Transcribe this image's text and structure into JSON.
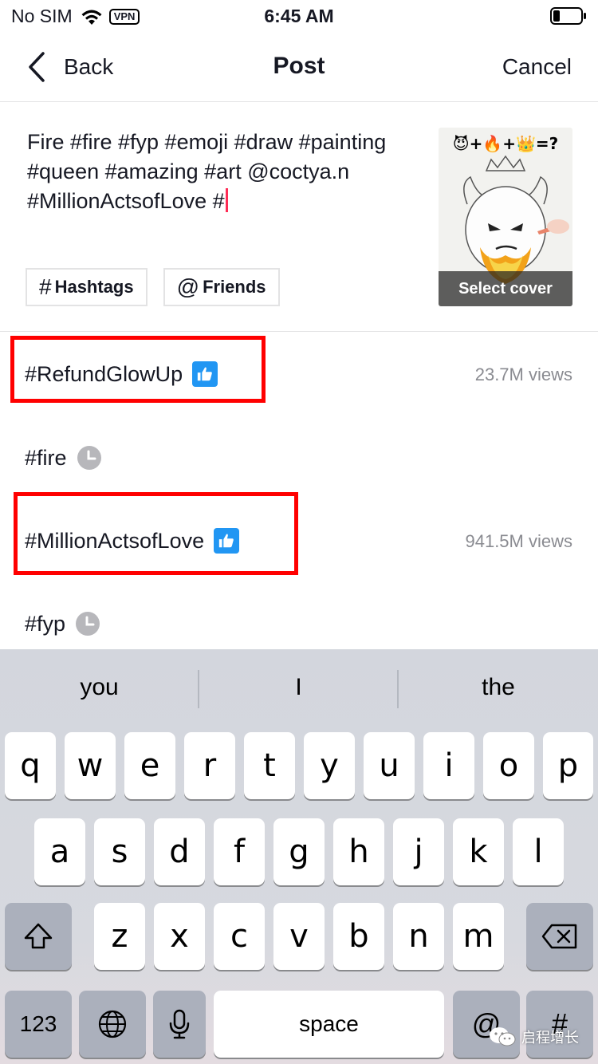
{
  "status_bar": {
    "carrier": "No SIM",
    "vpn": "VPN",
    "time": "6:45 AM"
  },
  "nav": {
    "back_label": "Back",
    "title": "Post",
    "cancel_label": "Cancel"
  },
  "caption": {
    "text": "Fire #fire #fyp #emoji #draw #painting #queen #amazing #art @coctya.n #MillionActsofLove #"
  },
  "buttons": {
    "hashtags_symbol": "#",
    "hashtags_label": "Hashtags",
    "friends_symbol": "@",
    "friends_label": "Friends"
  },
  "cover": {
    "overlay_text": "😈+🔥+👑=?",
    "label": "Select cover"
  },
  "suggestions": [
    {
      "name": "#RefundGlowUp",
      "badge": "thumbs-up",
      "views": "23.7M views",
      "highlighted": true
    },
    {
      "name": "#fire",
      "badge": "clock",
      "views": "",
      "highlighted": false
    },
    {
      "name": "#MillionActsofLove",
      "badge": "thumbs-up",
      "views": "941.5M views",
      "highlighted": true
    },
    {
      "name": "#fyp",
      "badge": "clock",
      "views": "",
      "highlighted": false
    }
  ],
  "keyboard": {
    "predictions": [
      "you",
      "I",
      "the"
    ],
    "row1": [
      "q",
      "w",
      "e",
      "r",
      "t",
      "y",
      "u",
      "i",
      "o",
      "p"
    ],
    "row2": [
      "a",
      "s",
      "d",
      "f",
      "g",
      "h",
      "j",
      "k",
      "l"
    ],
    "row3": [
      "z",
      "x",
      "c",
      "v",
      "b",
      "n",
      "m"
    ],
    "numbers_label": "123",
    "space_label": "space",
    "at_label": "@",
    "hash_label": "#"
  },
  "watermark": {
    "text": "启程增长"
  },
  "colors": {
    "highlight": "#ff0000",
    "accent_caret": "#fe2c55",
    "badge_blue": "#2196f3",
    "views_gray": "#8a8b91"
  }
}
